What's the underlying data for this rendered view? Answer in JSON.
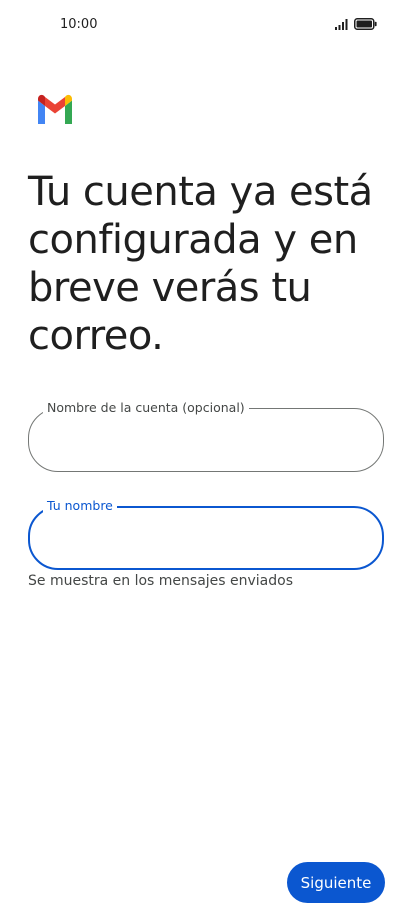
{
  "status_bar": {
    "time": "10:00",
    "signal_icon": "signal-bars-icon",
    "battery_icon": "battery-icon"
  },
  "logo": {
    "icon": "gmail-logo-icon",
    "colors": [
      "#4285F4",
      "#EA4335",
      "#FBBC04",
      "#34A853",
      "#C5221F"
    ]
  },
  "headline": "Tu cuenta ya está configurada y en breve verás tu correo.",
  "account_name_field": {
    "label": "Nombre de la cuenta (opcional)",
    "value": ""
  },
  "your_name_field": {
    "label": "Tu nombre",
    "value": "",
    "helper": "Se muestra en los mensajes enviados"
  },
  "next_button": {
    "label": "Siguiente"
  },
  "colors": {
    "accent": "#0b57d0",
    "outline": "#747775",
    "text": "#1f1f1f"
  }
}
